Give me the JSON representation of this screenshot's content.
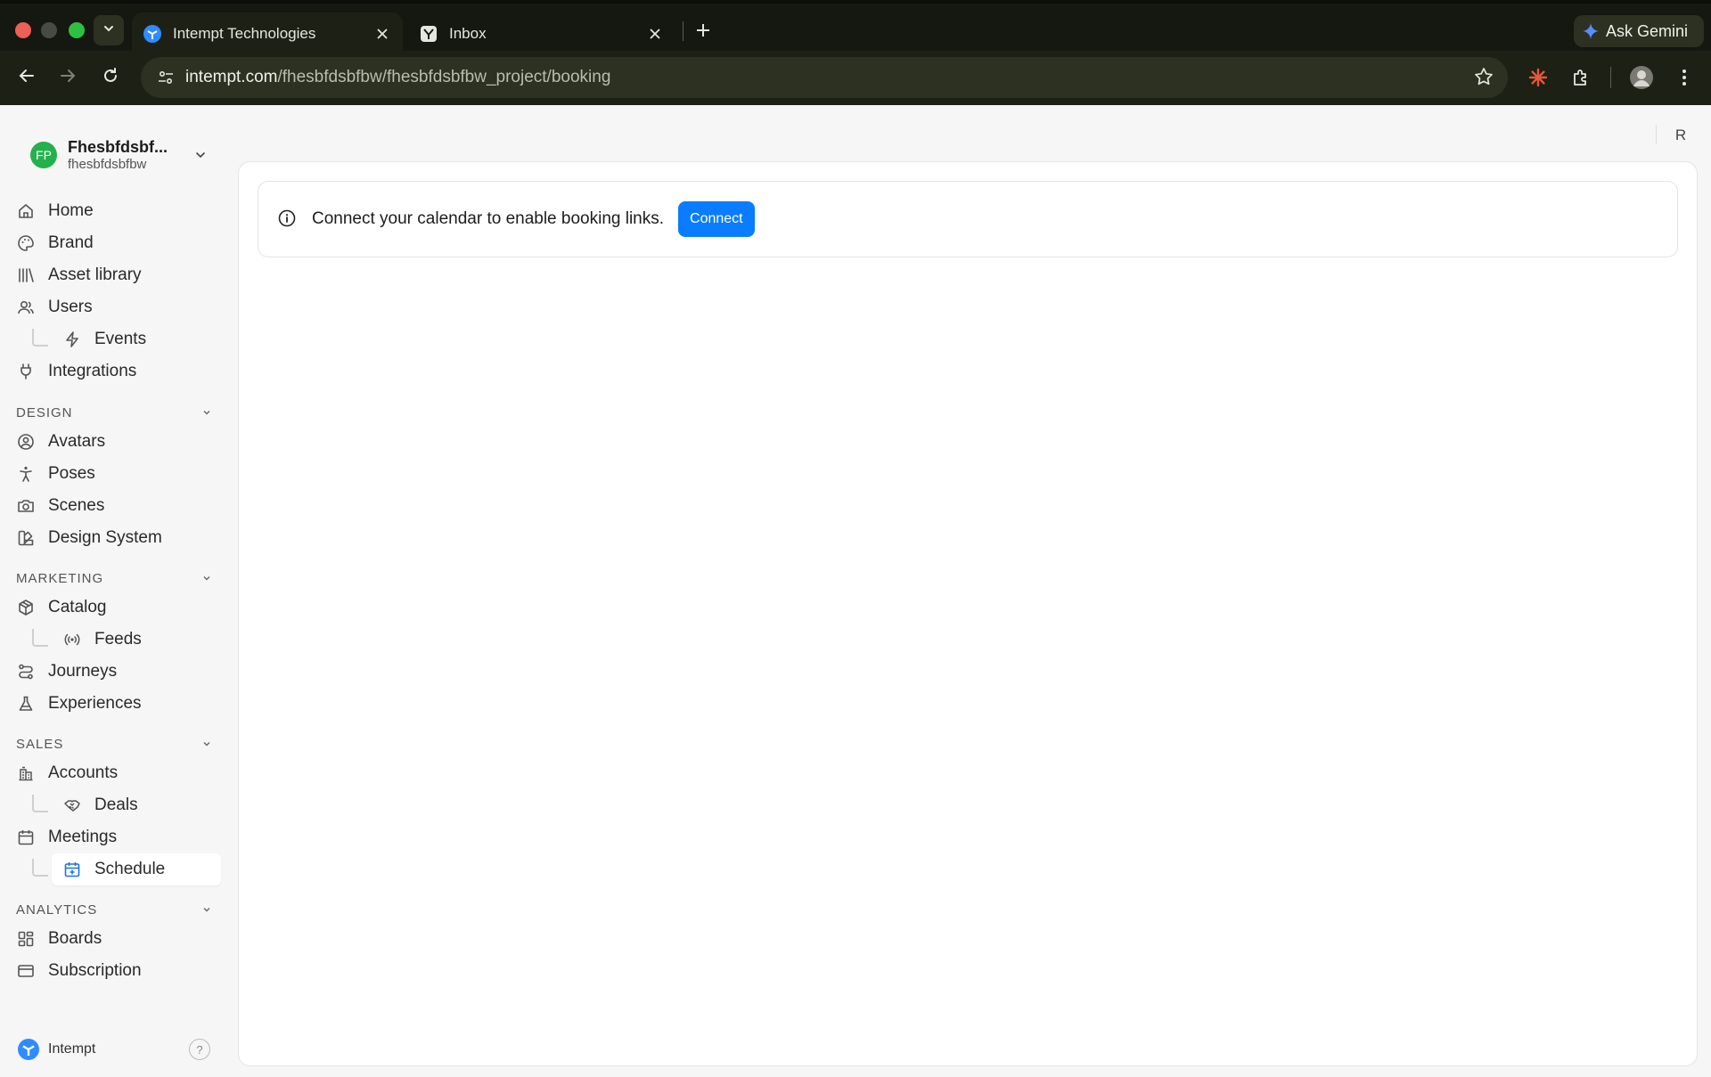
{
  "browser": {
    "tabs": [
      {
        "title": "Intempt Technologies",
        "active": true
      },
      {
        "title": "Inbox",
        "active": false
      }
    ],
    "url_host": "intempt.com",
    "url_path": "/fhesbfdsbfbw/fhesbfdsbfbw_project/booking",
    "gemini_label": "Ask Gemini"
  },
  "workspace": {
    "initials": "FP",
    "name": "Fhesbfdsbf...",
    "sub": "fhesbfdsbfbw"
  },
  "nav": {
    "home": "Home",
    "brand": "Brand",
    "asset_library": "Asset library",
    "users": "Users",
    "events": "Events",
    "integrations": "Integrations",
    "design_head": "DESIGN",
    "avatars": "Avatars",
    "poses": "Poses",
    "scenes": "Scenes",
    "design_system": "Design System",
    "marketing_head": "MARKETING",
    "catalog": "Catalog",
    "feeds": "Feeds",
    "journeys": "Journeys",
    "experiences": "Experiences",
    "sales_head": "SALES",
    "accounts": "Accounts",
    "deals": "Deals",
    "meetings": "Meetings",
    "schedule": "Schedule",
    "analytics_head": "ANALYTICS",
    "boards": "Boards",
    "subscription": "Subscription"
  },
  "footer": {
    "brand_name": "Intempt",
    "help": "?"
  },
  "header": {
    "user_initial": "R"
  },
  "banner": {
    "message": "Connect your calendar to enable booking links.",
    "button": "Connect"
  },
  "colors": {
    "accent": "#0a7cff",
    "avatar": "#22b14c"
  }
}
